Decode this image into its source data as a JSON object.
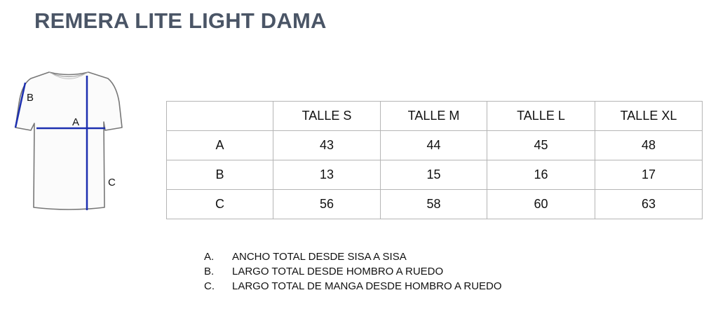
{
  "title": "REMERA LITE LIGHT DAMA",
  "diagram": {
    "labels": {
      "a": "A",
      "b": "B",
      "c": "C"
    },
    "line_color": "#1c2fb0",
    "shirt_stroke": "#777777"
  },
  "table": {
    "headers": [
      "",
      "TALLE S",
      "TALLE M",
      "TALLE L",
      "TALLE XL"
    ],
    "rows": [
      {
        "label": "A",
        "values": [
          "43",
          "44",
          "45",
          "48"
        ]
      },
      {
        "label": "B",
        "values": [
          "13",
          "15",
          "16",
          "17"
        ]
      },
      {
        "label": "C",
        "values": [
          "56",
          "58",
          "60",
          "63"
        ]
      }
    ]
  },
  "legend": [
    {
      "marker": "A.",
      "text": "ANCHO TOTAL DESDE SISA A SISA"
    },
    {
      "marker": "B.",
      "text": "LARGO TOTAL DESDE HOMBRO A RUEDO"
    },
    {
      "marker": "C.",
      "text": "LARGO TOTAL DE MANGA DESDE HOMBRO A RUEDO"
    }
  ]
}
